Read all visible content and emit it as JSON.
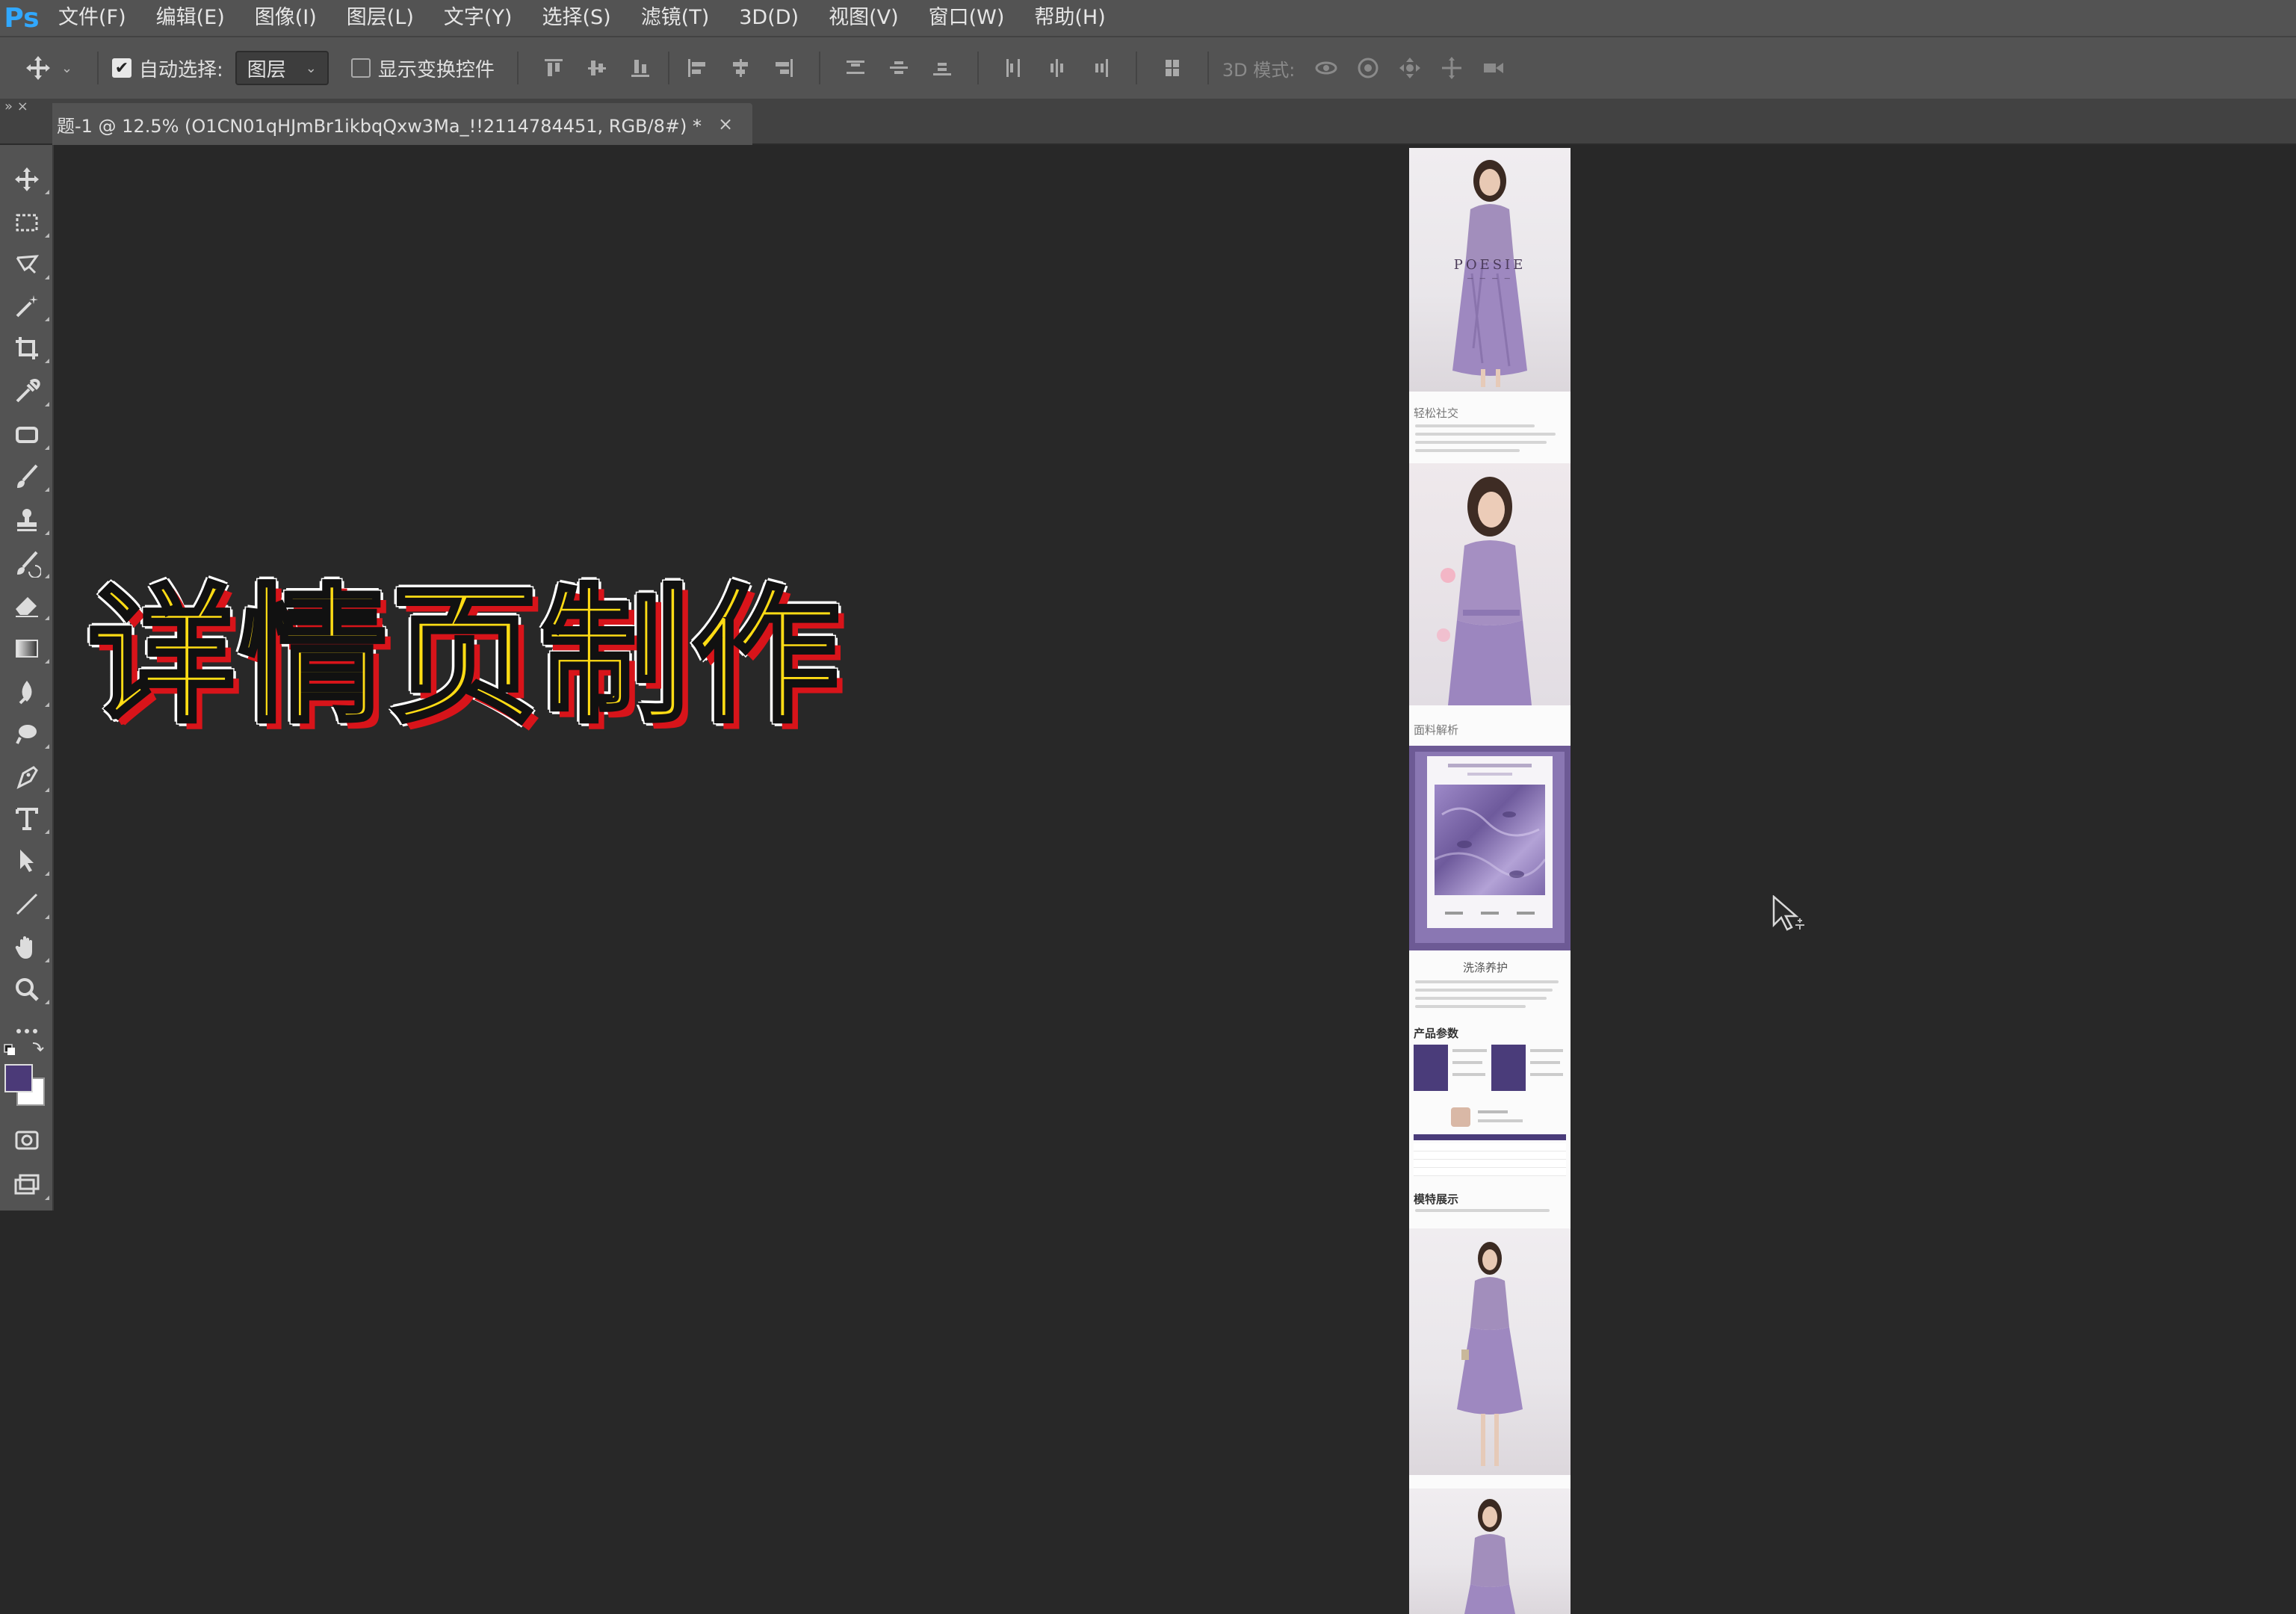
{
  "app": {
    "logo": "Ps",
    "accent_color": "#31a8ff"
  },
  "menu": {
    "items": [
      "文件(F)",
      "编辑(E)",
      "图像(I)",
      "图层(L)",
      "文字(Y)",
      "选择(S)",
      "滤镜(T)",
      "3D(D)",
      "视图(V)",
      "窗口(W)",
      "帮助(H)"
    ]
  },
  "options_bar": {
    "tool_icon": "move-tool-icon",
    "auto_select_label": "自动选择:",
    "auto_select_checked": true,
    "auto_select_target": "图层",
    "show_transform_label": "显示变换控件",
    "show_transform_checked": false,
    "mode_3d_label": "3D 模式:"
  },
  "document_tab": {
    "label": "题-1 @ 12.5% (O1CN01qHJmBr1ikbqQxw3Ma_!!2114784451, RGB/8#) *",
    "close": "×"
  },
  "toolbar": {
    "foreground_color": "#4b3a78",
    "background_color": "#ffffff",
    "tools": [
      "move-tool-icon",
      "marquee-tool-icon",
      "lasso-tool-icon",
      "magic-wand-tool-icon",
      "crop-tool-icon",
      "eyedropper-tool-icon",
      "frame-tool-icon",
      "brush-tool-icon",
      "stamp-tool-icon",
      "history-brush-tool-icon",
      "eraser-tool-icon",
      "gradient-tool-icon",
      "blur-tool-icon",
      "dodge-tool-icon",
      "pen-tool-icon",
      "type-tool-icon",
      "path-selection-tool-icon",
      "line-tool-icon",
      "hand-tool-icon",
      "zoom-tool-icon",
      "more-tools-icon"
    ]
  },
  "canvas": {
    "overlay_title": "详情页制作",
    "overlay_colors": {
      "fill": "#ffdc14",
      "shadow": "#d8141a",
      "outline": "#ffffff"
    },
    "document_sections": {
      "brand": "POESIE",
      "section1_header": "轻松社交",
      "section2_header": "面料解析",
      "section3_header": "洗涤养护",
      "section4_header": "产品参数",
      "section5_header": "模特展示"
    }
  }
}
